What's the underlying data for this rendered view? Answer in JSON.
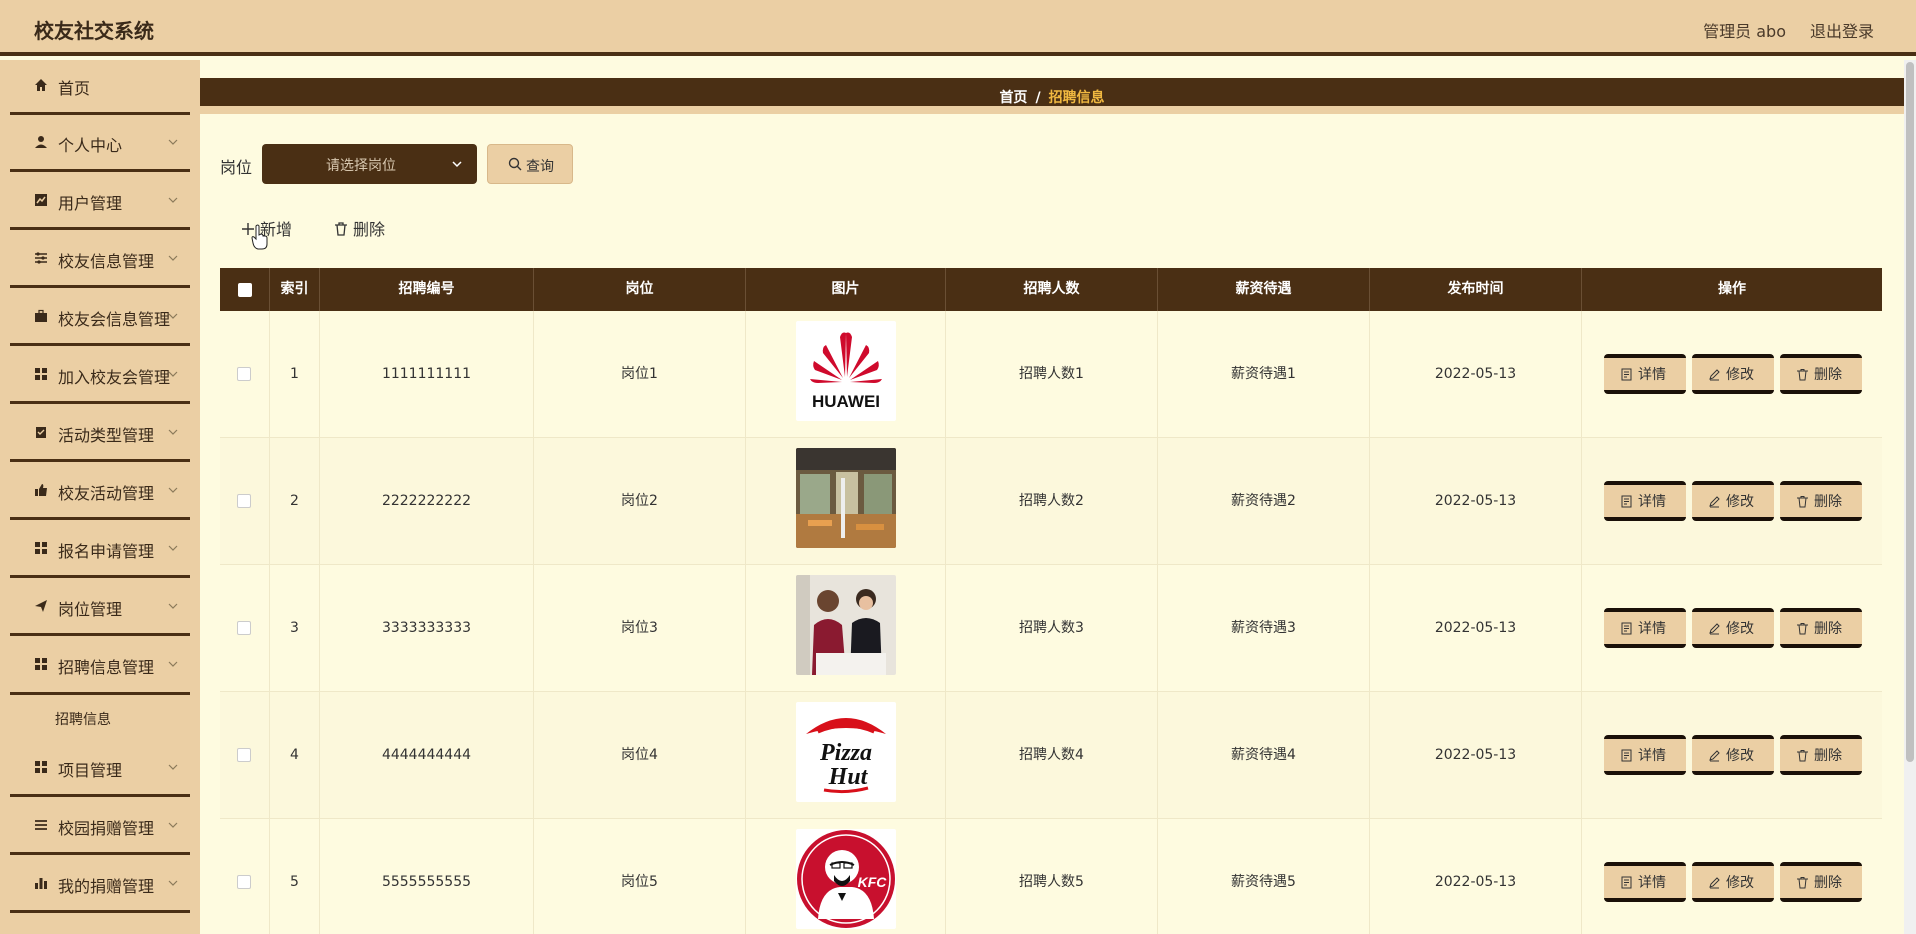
{
  "app": {
    "title": "校友社交系统",
    "user": "管理员 abo",
    "logout": "退出登录"
  },
  "sidebar": {
    "items": [
      {
        "label": "首页",
        "icon": "home-icon"
      },
      {
        "label": "个人中心",
        "icon": "person-icon"
      },
      {
        "label": "用户管理",
        "icon": "chart-icon"
      },
      {
        "label": "校友信息管理",
        "icon": "sliders-icon"
      },
      {
        "label": "校友会信息管理",
        "icon": "briefcase-icon"
      },
      {
        "label": "加入校友会管理",
        "icon": "grid-icon"
      },
      {
        "label": "活动类型管理",
        "icon": "clipboard-icon"
      },
      {
        "label": "校友活动管理",
        "icon": "thumb-icon"
      },
      {
        "label": "报名申请管理",
        "icon": "grid-icon"
      },
      {
        "label": "岗位管理",
        "icon": "send-icon"
      },
      {
        "label": "招聘信息管理",
        "icon": "grid-icon"
      },
      {
        "label": "项目管理",
        "icon": "grid-icon"
      },
      {
        "label": "校园捐赠管理",
        "icon": "list-icon"
      },
      {
        "label": "我的捐赠管理",
        "icon": "bar-chart-icon"
      }
    ],
    "sub_item": "招聘信息"
  },
  "breadcrumb": {
    "home": "首页",
    "sep": "/",
    "current": "招聘信息"
  },
  "filter": {
    "label": "岗位",
    "placeholder": "请选择岗位",
    "query": "查询"
  },
  "toolbar": {
    "add": "新增",
    "delete": "删除"
  },
  "table": {
    "headers": [
      "索引",
      "招聘编号",
      "岗位",
      "图片",
      "招聘人数",
      "薪资待遇",
      "发布时间",
      "操作"
    ],
    "rows": [
      {
        "index": "1",
        "code": "1111111111",
        "post": "岗位1",
        "image": "huawei-logo",
        "count": "招聘人数1",
        "salary": "薪资待遇1",
        "date": "2022-05-13"
      },
      {
        "index": "2",
        "code": "2222222222",
        "post": "岗位2",
        "image": "office-photo",
        "count": "招聘人数2",
        "salary": "薪资待遇2",
        "date": "2022-05-13"
      },
      {
        "index": "3",
        "code": "3333333333",
        "post": "岗位3",
        "image": "handshake-photo",
        "count": "招聘人数3",
        "salary": "薪资待遇3",
        "date": "2022-05-13"
      },
      {
        "index": "4",
        "code": "4444444444",
        "post": "岗位4",
        "image": "pizzahut-logo",
        "count": "招聘人数4",
        "salary": "薪资待遇4",
        "date": "2022-05-13"
      },
      {
        "index": "5",
        "code": "5555555555",
        "post": "岗位5",
        "image": "kfc-logo",
        "count": "招聘人数5",
        "salary": "薪资待遇5",
        "date": "2022-05-13"
      }
    ],
    "actions": {
      "detail": "详情",
      "edit": "修改",
      "delete": "删除"
    }
  },
  "logos": {
    "huawei": "HUAWEI",
    "pizza": "Pizza",
    "hut": "Hut",
    "kfc": "KFC"
  },
  "colors": {
    "header": "#ebcfa4",
    "dark": "#4a2f14",
    "bg": "#fefbe0",
    "accent": "#f0b840"
  }
}
